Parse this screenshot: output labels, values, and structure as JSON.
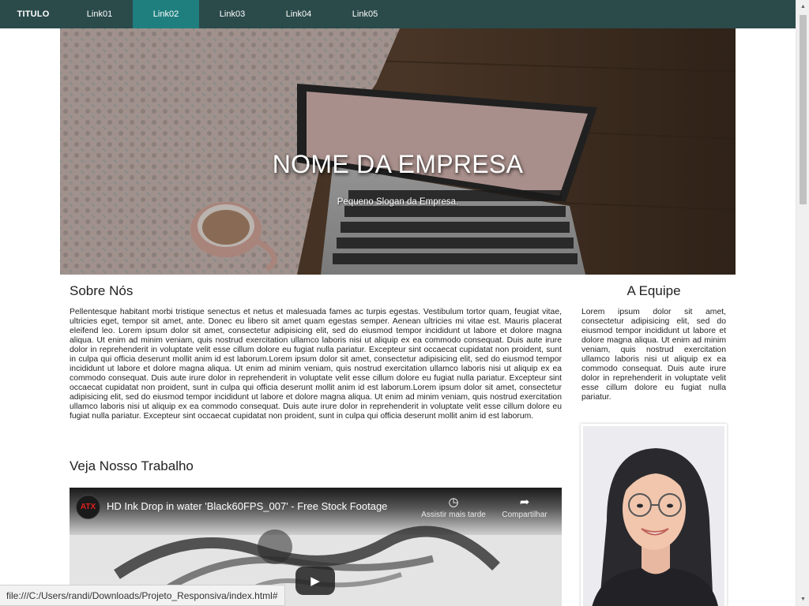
{
  "navbar": {
    "brand": "TITULO",
    "links": [
      "Link01",
      "Link02",
      "Link03",
      "Link04",
      "Link05"
    ],
    "active_link": "Link02"
  },
  "hero": {
    "title": "NOME DA EMPRESA",
    "slogan": "Pequeno Slogan da Empresa."
  },
  "about": {
    "title": "Sobre Nós",
    "text": "Pellentesque habitant morbi tristique senectus et netus et malesuada fames ac turpis egestas. Vestibulum tortor quam, feugiat vitae, ultricies eget, tempor sit amet, ante. Donec eu libero sit amet quam egestas semper. Aenean ultricies mi vitae est. Mauris placerat eleifend leo. Lorem ipsum dolor sit amet, consectetur adipisicing elit, sed do eiusmod tempor incididunt ut labore et dolore magna aliqua. Ut enim ad minim veniam, quis nostrud exercitation ullamco laboris nisi ut aliquip ex ea commodo consequat. Duis aute irure dolor in reprehenderit in voluptate velit esse cillum dolore eu fugiat nulla pariatur. Excepteur sint occaecat cupidatat non proident, sunt in culpa qui officia deserunt mollit anim id est laborum.Lorem ipsum dolor sit amet, consectetur adipisicing elit, sed do eiusmod tempor incididunt ut labore et dolore magna aliqua. Ut enim ad minim veniam, quis nostrud exercitation ullamco laboris nisi ut aliquip ex ea commodo consequat. Duis aute irure dolor in reprehenderit in voluptate velit esse cillum dolore eu fugiat nulla pariatur. Excepteur sint occaecat cupidatat non proident, sunt in culpa qui officia deserunt mollit anim id est laborum.Lorem ipsum dolor sit amet, consectetur adipisicing elit, sed do eiusmod tempor incididunt ut labore et dolore magna aliqua. Ut enim ad minim veniam, quis nostrud exercitation ullamco laboris nisi ut aliquip ex ea commodo consequat. Duis aute irure dolor in reprehenderit in voluptate velit esse cillum dolore eu fugiat nulla pariatur. Excepteur sint occaecat cupidatat non proident, sunt in culpa qui officia deserunt mollit anim id est laborum."
  },
  "work": {
    "title": "Veja Nosso Trabalho",
    "video": {
      "title": "HD Ink Drop in water 'Black60FPS_007' - Free Stock Footage",
      "watch_later_label": "Assistir mais tarde",
      "share_label": "Compartilhar",
      "icons": [
        "channel-logo-icon",
        "clock-icon",
        "share-icon",
        "play-icon"
      ]
    }
  },
  "team": {
    "title": "A Equipe",
    "text": "Lorem ipsum dolor sit amet, consectetur adipisicing elit, sed do eiusmod tempor incididunt ut labore et dolore magna aliqua. Ut enim ad minim veniam, quis nostrud exercitation ullamco laboris nisi ut aliquip ex ea commodo consequat. Duis aute irure dolor in reprehenderit in voluptate velit esse cillum dolore eu fugiat nulla pariatur."
  },
  "statusbar": {
    "url": "file:///C:/Users/randi/Downloads/Projeto_Responsiva/index.html#"
  },
  "colors": {
    "navbar": "#2b4a4a",
    "navbar_active": "#1f7f7f",
    "text": "#222222"
  }
}
